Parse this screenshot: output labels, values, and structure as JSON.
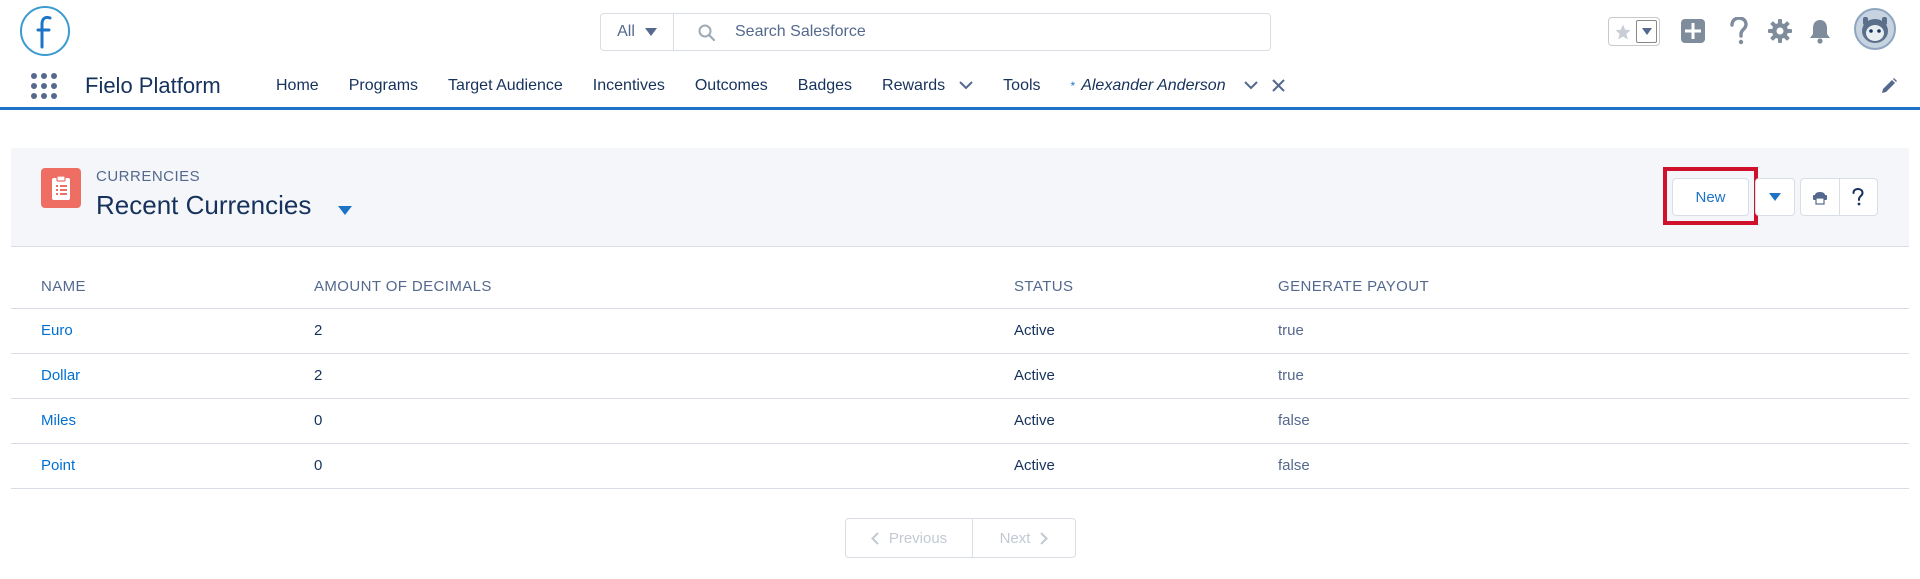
{
  "header": {
    "search": {
      "scope": "All",
      "placeholder": "Search Salesforce"
    }
  },
  "nav": {
    "app_name": "Fielo Platform",
    "items": [
      "Home",
      "Programs",
      "Target Audience",
      "Incentives",
      "Outcomes",
      "Badges",
      "Rewards",
      "Tools"
    ],
    "active_tab": {
      "marker": "*",
      "label": "Alexander Anderson"
    }
  },
  "list_view": {
    "object_label": "CURRENCIES",
    "title": "Recent Currencies",
    "new_button": "New",
    "columns": [
      "NAME",
      "AMOUNT OF DECIMALS",
      "STATUS",
      "GENERATE PAYOUT"
    ],
    "rows": [
      {
        "name": "Euro",
        "decimals": "2",
        "status": "Active",
        "payout": "true"
      },
      {
        "name": "Dollar",
        "decimals": "2",
        "status": "Active",
        "payout": "true"
      },
      {
        "name": "Miles",
        "decimals": "0",
        "status": "Active",
        "payout": "false"
      },
      {
        "name": "Point",
        "decimals": "0",
        "status": "Active",
        "payout": "false"
      }
    ],
    "pager": {
      "previous": "Previous",
      "next": "Next"
    }
  },
  "colors": {
    "brand_blue": "#1d73c6",
    "link_blue": "#0070d2",
    "object_icon": "#ef6e64",
    "highlight_red": "#d0112b"
  },
  "icons": [
    "fielo-logo",
    "chevron-down-icon",
    "search-icon",
    "star-icon",
    "add-icon",
    "help-icon",
    "gear-icon",
    "bell-icon",
    "avatar",
    "app-launcher-icon",
    "close-icon",
    "pencil-icon",
    "currency-object-icon",
    "printer-icon",
    "chevron-left-icon",
    "chevron-right-icon"
  ]
}
